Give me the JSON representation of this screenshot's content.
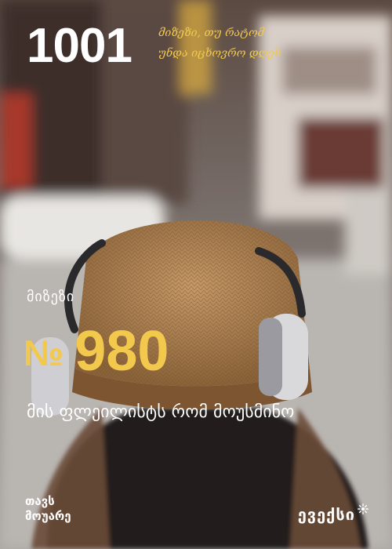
{
  "logo": {
    "number": "1001",
    "tagline_line1": "მიზეზი, თუ რატომ",
    "tagline_line2": "უნდა იცხოვრო დღეს"
  },
  "reason": {
    "label": "მიზეზი",
    "number_sign": "№",
    "number": "980",
    "text": "მის ფლეილისტს რომ მოუსმინო"
  },
  "footer": {
    "left_line1": "თავს",
    "left_line2": "მოუარე",
    "brand": "ევექსი"
  },
  "colors": {
    "accent_yellow": "#f2c94c",
    "text_white": "#ffffff"
  },
  "icons": {
    "brand_icon": "sun-burst-icon"
  }
}
